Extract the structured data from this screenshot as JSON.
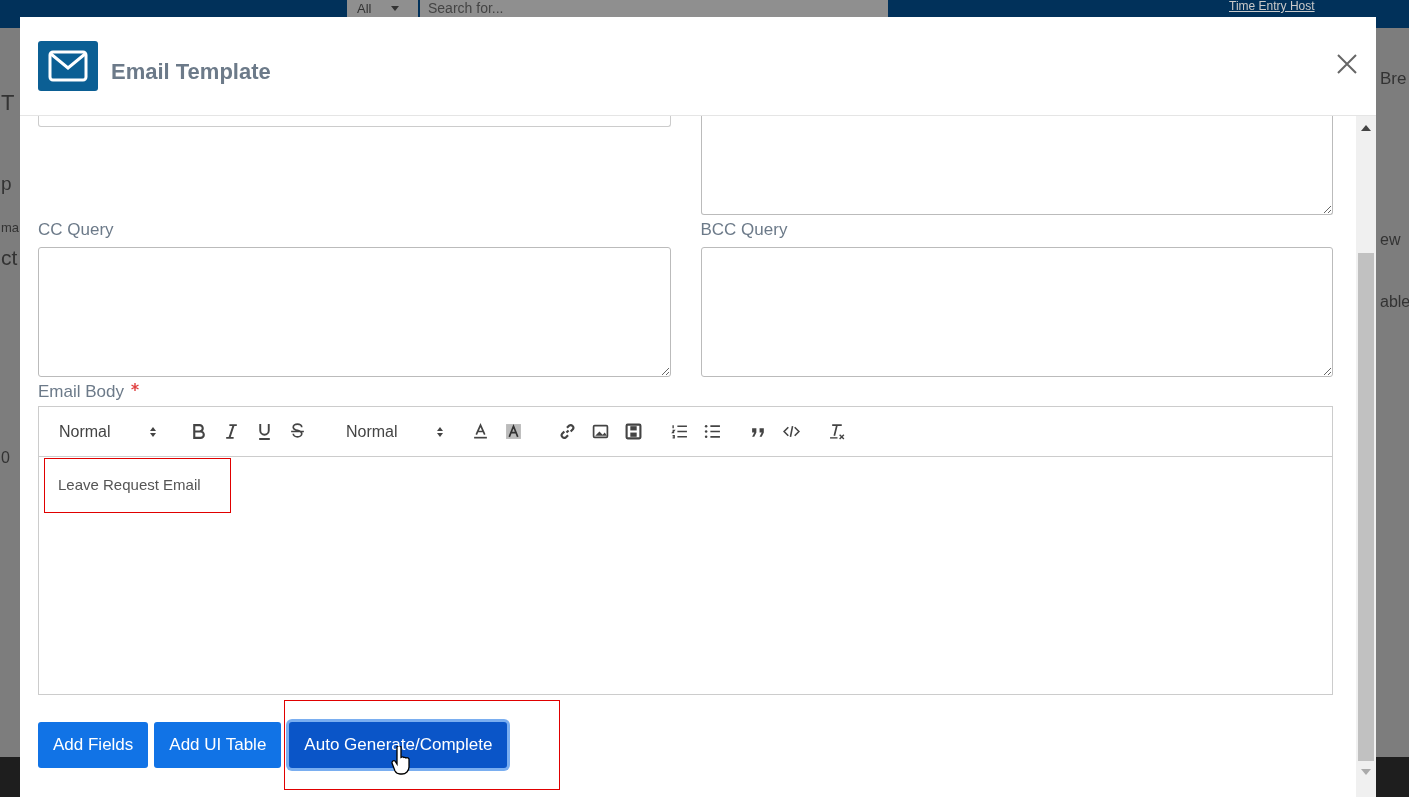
{
  "background": {
    "search_scope": "All",
    "search_placeholder": "Search for...",
    "link": "Time Entry Host",
    "left_fragments": [
      "T",
      "p",
      "ma",
      "ct",
      "0"
    ],
    "right_fragments": [
      "Bre",
      "ew",
      "able"
    ]
  },
  "modal": {
    "title": "Email Template",
    "fields": [
      {
        "label": "CC Query",
        "required": false
      },
      {
        "label": "BCC Query",
        "required": false
      }
    ],
    "email_body": {
      "label": "Email Body",
      "required": true,
      "toolbar_groups": [
        {
          "items": [
            {
              "kind": "select",
              "label": "Normal"
            }
          ]
        },
        {
          "items": [
            {
              "kind": "bold"
            },
            {
              "kind": "italic"
            },
            {
              "kind": "underline"
            },
            {
              "kind": "strike"
            }
          ]
        },
        {
          "items": [
            {
              "kind": "select",
              "label": "Normal"
            }
          ]
        },
        {
          "items": [
            {
              "kind": "color"
            },
            {
              "kind": "background"
            }
          ]
        },
        {
          "items": [
            {
              "kind": "link"
            },
            {
              "kind": "image"
            },
            {
              "kind": "video"
            }
          ]
        },
        {
          "items": [
            {
              "kind": "ordered-list"
            },
            {
              "kind": "bullet-list"
            }
          ]
        },
        {
          "items": [
            {
              "kind": "quote"
            },
            {
              "kind": "code"
            }
          ]
        },
        {
          "items": [
            {
              "kind": "clean"
            }
          ]
        }
      ],
      "content": "Leave Request Email",
      "highlighted": true
    },
    "buttons": [
      {
        "label": "Add Fields",
        "focused": false,
        "highlighted": false
      },
      {
        "label": "Add UI Table",
        "focused": false,
        "highlighted": false
      },
      {
        "label": "Auto Generate/Complete",
        "focused": true,
        "highlighted": true
      }
    ]
  }
}
